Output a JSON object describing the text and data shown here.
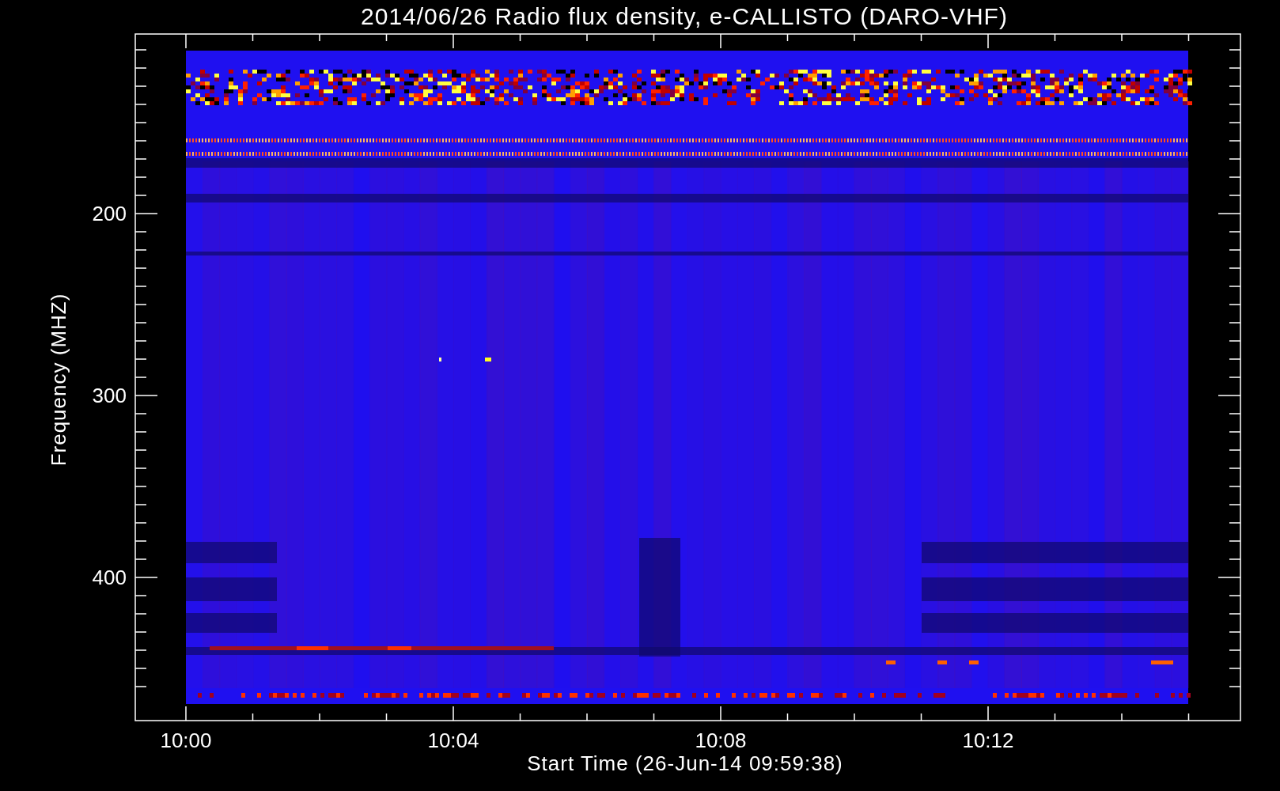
{
  "title": "2014/06/26  Radio flux density, e-CALLISTO (DARO-VHF)",
  "y_axis": {
    "label": "Frequency (MHZ)",
    "ticks": [
      "200",
      "300",
      "400"
    ]
  },
  "x_axis": {
    "label": "Start Time (26-Jun-14 09:59:38)",
    "ticks": [
      "10:00",
      "10:04",
      "10:08",
      "10:12"
    ]
  }
}
